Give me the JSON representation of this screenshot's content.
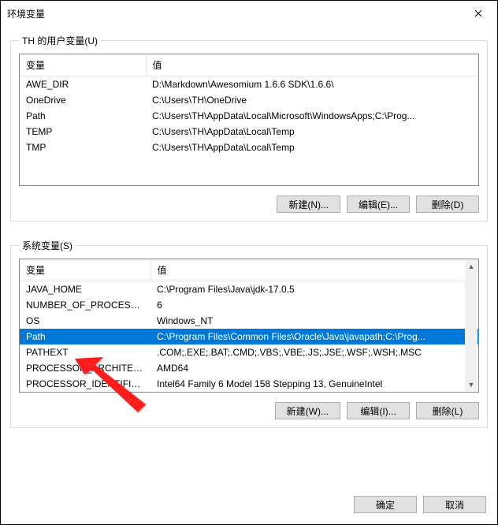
{
  "window": {
    "title": "环境变量"
  },
  "user_section": {
    "legend": "TH 的用户变量(U)",
    "col_var": "变量",
    "col_val": "值",
    "rows": [
      {
        "var": "AWE_DIR",
        "val": "D:\\Markdown\\Awesomium 1.6.6 SDK\\1.6.6\\"
      },
      {
        "var": "OneDrive",
        "val": "C:\\Users\\TH\\OneDrive"
      },
      {
        "var": "Path",
        "val": "C:\\Users\\TH\\AppData\\Local\\Microsoft\\WindowsApps;C:\\Prog..."
      },
      {
        "var": "TEMP",
        "val": "C:\\Users\\TH\\AppData\\Local\\Temp"
      },
      {
        "var": "TMP",
        "val": "C:\\Users\\TH\\AppData\\Local\\Temp"
      }
    ],
    "btn_new": "新建(N)...",
    "btn_edit": "编辑(E)...",
    "btn_del": "删除(D)"
  },
  "sys_section": {
    "legend": "系统变量(S)",
    "col_var": "变量",
    "col_val": "值",
    "rows": [
      {
        "var": "JAVA_HOME",
        "val": "C:\\Program Files\\Java\\jdk-17.0.5",
        "sel": false
      },
      {
        "var": "NUMBER_OF_PROCESSORS",
        "val": "6",
        "sel": false
      },
      {
        "var": "OS",
        "val": "Windows_NT",
        "sel": false
      },
      {
        "var": "Path",
        "val": "C:\\Program Files\\Common Files\\Oracle\\Java\\javapath;C:\\Prog...",
        "sel": true
      },
      {
        "var": "PATHEXT",
        "val": ".COM;.EXE;.BAT;.CMD;.VBS;.VBE;.JS;.JSE;.WSF;.WSH;.MSC",
        "sel": false
      },
      {
        "var": "PROCESSOR_ARCHITECT...",
        "val": "AMD64",
        "sel": false
      },
      {
        "var": "PROCESSOR_IDENTIFIER",
        "val": "Intel64 Family 6 Model 158 Stepping 13, GenuineIntel",
        "sel": false
      }
    ],
    "btn_new": "新建(W)...",
    "btn_edit": "编辑(I)...",
    "btn_del": "删除(L)"
  },
  "footer": {
    "ok": "确定",
    "cancel": "取消"
  }
}
